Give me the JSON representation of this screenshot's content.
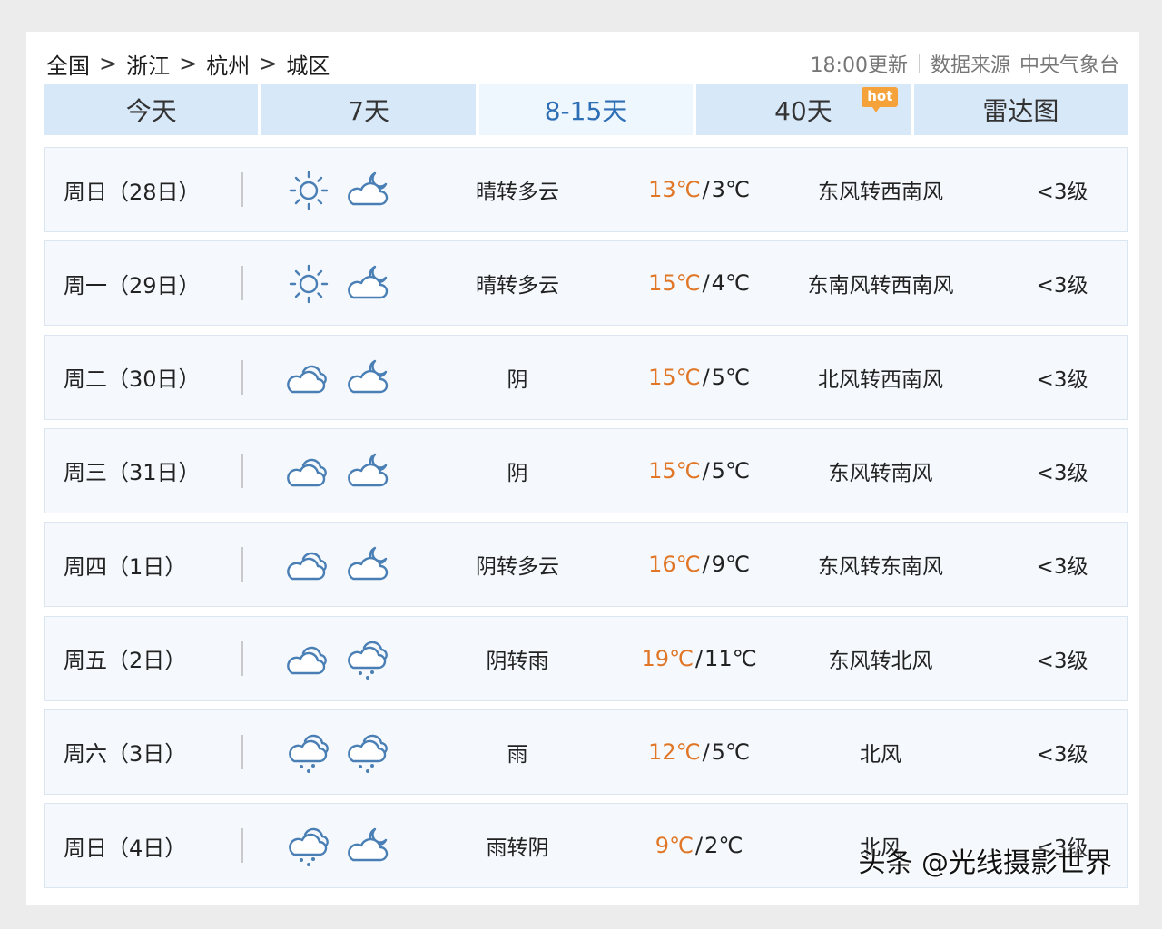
{
  "breadcrumb": [
    "全国",
    "浙江",
    "杭州",
    "城区"
  ],
  "breadcrumb_sep": ">",
  "update_time": "18:00更新",
  "source_label": "数据来源",
  "source_name": "中央气象台",
  "tabs": [
    {
      "label": "今天",
      "active": false
    },
    {
      "label": "7天",
      "active": false
    },
    {
      "label": "8-15天",
      "active": true
    },
    {
      "label": "40天",
      "active": false,
      "badge": "hot"
    },
    {
      "label": "雷达图",
      "active": false
    }
  ],
  "forecast": [
    {
      "date": "周日（28日）",
      "icon1": "sunny-icon",
      "icon2": "cloudy-night-icon",
      "desc": "晴转多云",
      "hi": "13℃",
      "lo": "3℃",
      "wind": "东风转西南风",
      "level": "<3级"
    },
    {
      "date": "周一（29日）",
      "icon1": "sunny-icon",
      "icon2": "cloudy-night-icon",
      "desc": "晴转多云",
      "hi": "15℃",
      "lo": "4℃",
      "wind": "东南风转西南风",
      "level": "<3级"
    },
    {
      "date": "周二（30日）",
      "icon1": "overcast-icon",
      "icon2": "cloudy-night-icon",
      "desc": "阴",
      "hi": "15℃",
      "lo": "5℃",
      "wind": "北风转西南风",
      "level": "<3级"
    },
    {
      "date": "周三（31日）",
      "icon1": "overcast-icon",
      "icon2": "cloudy-night-icon",
      "desc": "阴",
      "hi": "15℃",
      "lo": "5℃",
      "wind": "东风转南风",
      "level": "<3级"
    },
    {
      "date": "周四（1日）",
      "icon1": "overcast-icon",
      "icon2": "cloudy-night-icon",
      "desc": "阴转多云",
      "hi": "16℃",
      "lo": "9℃",
      "wind": "东风转东南风",
      "level": "<3级"
    },
    {
      "date": "周五（2日）",
      "icon1": "overcast-icon",
      "icon2": "rain-icon",
      "desc": "阴转雨",
      "hi": "19℃",
      "lo": "11℃",
      "wind": "东风转北风",
      "level": "<3级"
    },
    {
      "date": "周六（3日）",
      "icon1": "rain-icon",
      "icon2": "rain-icon",
      "desc": "雨",
      "hi": "12℃",
      "lo": "5℃",
      "wind": "北风",
      "level": "<3级"
    },
    {
      "date": "周日（4日）",
      "icon1": "rain-icon",
      "icon2": "cloudy-night-icon",
      "desc": "雨转阴",
      "hi": "9℃",
      "lo": "2℃",
      "wind": "北风",
      "level": "<3级"
    }
  ],
  "watermark": "头条 @光线摄影世界",
  "colors": {
    "accent": "#2d6eb5",
    "high_temp": "#e07626",
    "tab_bg": "#d7e8f8",
    "row_bg": "#f5f9fd",
    "hot_badge": "#f5a23b",
    "icon_stroke": "#4a7fb5"
  }
}
